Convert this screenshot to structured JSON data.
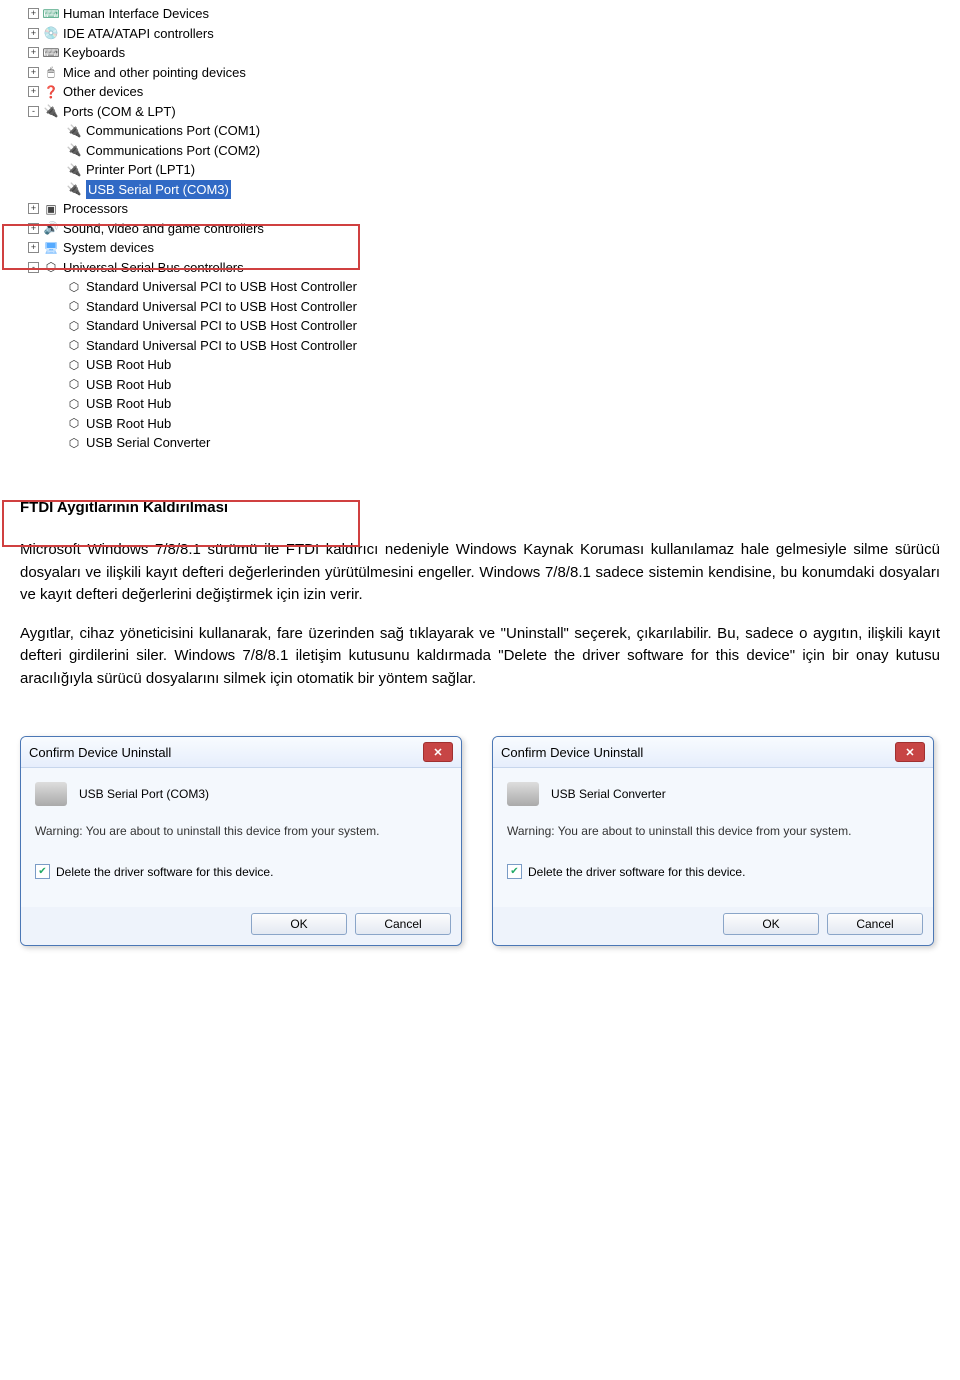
{
  "tree": {
    "items": [
      {
        "expand": "+",
        "icon": "⌨",
        "iconClass": "icon-hid",
        "label": "Human Interface Devices",
        "indent": 0
      },
      {
        "expand": "+",
        "icon": "💿",
        "iconClass": "icon-ide",
        "label": "IDE ATA/ATAPI controllers",
        "indent": 0
      },
      {
        "expand": "+",
        "icon": "⌨",
        "iconClass": "icon-kb",
        "label": "Keyboards",
        "indent": 0
      },
      {
        "expand": "+",
        "icon": "🖱",
        "iconClass": "icon-mouse",
        "label": "Mice and other pointing devices",
        "indent": 0
      },
      {
        "expand": "+",
        "icon": "❓",
        "iconClass": "icon-other",
        "label": "Other devices",
        "indent": 0
      },
      {
        "expand": "-",
        "icon": "🔌",
        "iconClass": "icon-port",
        "label": "Ports (COM & LPT)",
        "indent": 0
      },
      {
        "expand": "",
        "icon": "🔌",
        "iconClass": "icon-port",
        "label": "Communications Port (COM1)",
        "indent": 1
      },
      {
        "expand": "",
        "icon": "🔌",
        "iconClass": "icon-port",
        "label": "Communications Port (COM2)",
        "indent": 1
      },
      {
        "expand": "",
        "icon": "🔌",
        "iconClass": "icon-port",
        "label": "Printer Port (LPT1)",
        "indent": 1
      },
      {
        "expand": "",
        "icon": "🔌",
        "iconClass": "icon-port",
        "label": "USB Serial Port (COM3)",
        "indent": 1,
        "selected": true
      },
      {
        "expand": "+",
        "icon": "▣",
        "iconClass": "icon-cpu",
        "label": "Processors",
        "indent": 0
      },
      {
        "expand": "+",
        "icon": "🔊",
        "iconClass": "icon-sound",
        "label": "Sound, video and game controllers",
        "indent": 0
      },
      {
        "expand": "+",
        "icon": "🖥",
        "iconClass": "icon-sys",
        "label": "System devices",
        "indent": 0
      },
      {
        "expand": "-",
        "icon": "⬡",
        "iconClass": "icon-usb",
        "label": "Universal Serial Bus controllers",
        "indent": 0
      },
      {
        "expand": "",
        "icon": "⬡",
        "iconClass": "icon-usb",
        "label": "Standard Universal PCI to USB Host Controller",
        "indent": 1
      },
      {
        "expand": "",
        "icon": "⬡",
        "iconClass": "icon-usb",
        "label": "Standard Universal PCI to USB Host Controller",
        "indent": 1
      },
      {
        "expand": "",
        "icon": "⬡",
        "iconClass": "icon-usb",
        "label": "Standard Universal PCI to USB Host Controller",
        "indent": 1
      },
      {
        "expand": "",
        "icon": "⬡",
        "iconClass": "icon-usb",
        "label": "Standard Universal PCI to USB Host Controller",
        "indent": 1
      },
      {
        "expand": "",
        "icon": "⬡",
        "iconClass": "icon-usb",
        "label": "USB Root Hub",
        "indent": 1
      },
      {
        "expand": "",
        "icon": "⬡",
        "iconClass": "icon-usb",
        "label": "USB Root Hub",
        "indent": 1
      },
      {
        "expand": "",
        "icon": "⬡",
        "iconClass": "icon-usb",
        "label": "USB Root Hub",
        "indent": 1
      },
      {
        "expand": "",
        "icon": "⬡",
        "iconClass": "icon-usb",
        "label": "USB Root Hub",
        "indent": 1
      },
      {
        "expand": "",
        "icon": "⬡",
        "iconClass": "icon-usb",
        "label": "USB Serial Converter",
        "indent": 1
      }
    ]
  },
  "article": {
    "heading": "FTDI Aygıtlarının Kaldırılması",
    "p1": "Microsoft Windows 7/8/8.1 sürümü ile FTDI kaldırıcı nedeniyle Windows Kaynak Koruması kullanılamaz hale gelmesiyle silme sürücü dosyaları ve ilişkili kayıt defteri değerlerinden yürütülmesini engeller. Windows 7/8/8.1 sadece sistemin kendisine, bu konumdaki dosyaları ve kayıt defteri değerlerini değiştirmek için izin verir.",
    "p2": "Aygıtlar, cihaz yöneticisini kullanarak, fare üzerinden sağ tıklayarak ve \"Uninstall\" seçerek, çıkarılabilir. Bu, sadece o aygıtın, ilişkili kayıt defteri girdilerini siler. Windows 7/8/8.1 iletişim kutusunu kaldırmada \"Delete the driver software for this device\" için bir onay kutusu aracılığıyla sürücü dosyalarını silmek için otomatik bir yöntem sağlar."
  },
  "dialog1": {
    "title": "Confirm Device Uninstall",
    "device": "USB Serial Port (COM3)",
    "warning": "Warning: You are about to uninstall this device from your system.",
    "checkbox": "Delete the driver software for this device.",
    "checked": true,
    "ok": "OK",
    "cancel": "Cancel"
  },
  "dialog2": {
    "title": "Confirm Device Uninstall",
    "device": "USB Serial Converter",
    "warning": "Warning: You are about to uninstall this device from your system.",
    "checkbox": "Delete the driver software for this device.",
    "checked": true,
    "ok": "OK",
    "cancel": "Cancel"
  }
}
